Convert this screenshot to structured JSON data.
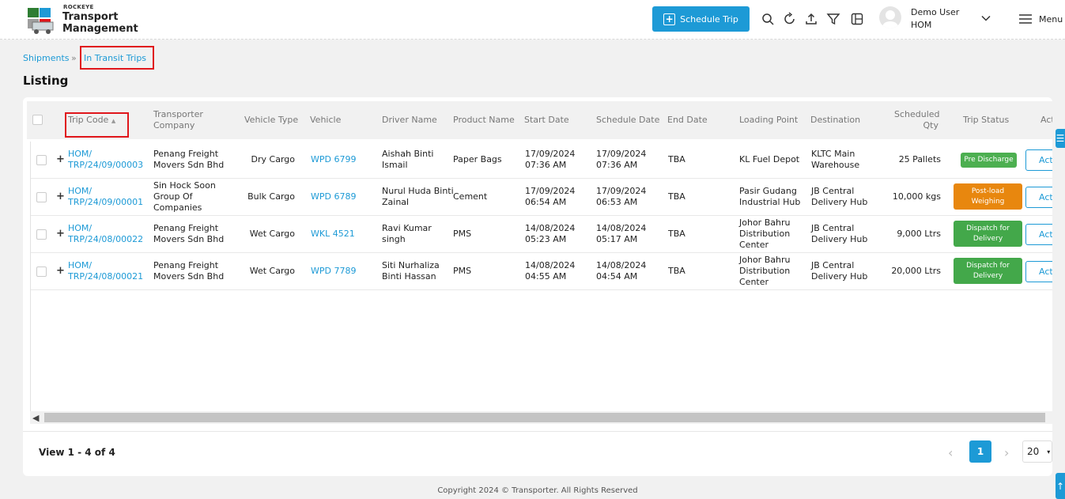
{
  "brand": {
    "small": "ROCKEYE",
    "line1": "Transport",
    "line2": "Management"
  },
  "header": {
    "schedule_label": "Schedule Trip",
    "user_name": "Demo User",
    "user_org": "HOM",
    "menu_label": "Menu"
  },
  "breadcrumb": {
    "parent": "Shipments",
    "separator": "»",
    "current": "In Transit Trips"
  },
  "page_title": "Listing",
  "columns": {
    "trip_code": "Trip Code",
    "transporter_1": "Transporter",
    "transporter_2": "Company",
    "vehicle_type": "Vehicle Type",
    "vehicle": "Vehicle",
    "driver": "Driver Name",
    "product": "Product Name",
    "start_date": "Start Date",
    "schedule_date": "Schedule Date",
    "end_date": "End Date",
    "loading_point": "Loading Point",
    "destination": "Destination",
    "scheduled_1": "Scheduled",
    "scheduled_2": "Qty",
    "trip_status": "Trip Status",
    "action": "Action"
  },
  "rows": [
    {
      "code1": "HOM/",
      "code2": "TRP/24/09/00003",
      "company": [
        "Penang Freight",
        "Movers Sdn Bhd"
      ],
      "vehicle_type": "Dry Cargo",
      "vehicle": "WPD 6799",
      "driver": [
        "Aishah Binti",
        "Ismail"
      ],
      "product": "Paper Bags",
      "start": [
        "17/09/2024",
        "07:36 AM"
      ],
      "schedule": [
        "17/09/2024",
        "07:36 AM"
      ],
      "end": "TBA",
      "loading": [
        "KL Fuel Depot"
      ],
      "destination": [
        "KLTC Main",
        "Warehouse"
      ],
      "qty": "25 Pallets",
      "status": [
        "Pre Discharge"
      ],
      "status_color": "#4caf50",
      "action": "Action"
    },
    {
      "code1": "HOM/",
      "code2": "TRP/24/09/00001",
      "company": [
        "Sin Hock Soon",
        "Group Of",
        "Companies"
      ],
      "vehicle_type": "Bulk Cargo",
      "vehicle": "WPD 6789",
      "driver": [
        "Nurul Huda Binti",
        "Zainal"
      ],
      "product": "Cement",
      "start": [
        "17/09/2024",
        "06:54 AM"
      ],
      "schedule": [
        "17/09/2024",
        "06:53 AM"
      ],
      "end": "TBA",
      "loading": [
        "Pasir Gudang",
        "Industrial Hub"
      ],
      "destination": [
        "JB Central",
        "Delivery Hub"
      ],
      "qty": "10,000 kgs",
      "status": [
        "Post-load",
        "Weighing"
      ],
      "status_color": "#e8870e",
      "action": "Action"
    },
    {
      "code1": "HOM/",
      "code2": "TRP/24/08/00022",
      "company": [
        "Penang Freight",
        "Movers Sdn Bhd"
      ],
      "vehicle_type": "Wet Cargo",
      "vehicle": "WKL 4521",
      "driver": [
        "Ravi Kumar",
        "singh"
      ],
      "product": "PMS",
      "start": [
        "14/08/2024",
        "05:23 AM"
      ],
      "schedule": [
        "14/08/2024",
        "05:17 AM"
      ],
      "end": "TBA",
      "loading": [
        "Johor Bahru",
        "Distribution",
        "Center"
      ],
      "destination": [
        "JB Central",
        "Delivery Hub"
      ],
      "qty": "9,000 Ltrs",
      "status": [
        "Dispatch for",
        "Delivery"
      ],
      "status_color": "#43a84a",
      "action": "Action"
    },
    {
      "code1": "HOM/",
      "code2": "TRP/24/08/00021",
      "company": [
        "Penang Freight",
        "Movers Sdn Bhd"
      ],
      "vehicle_type": "Wet Cargo",
      "vehicle": "WPD 7789",
      "driver": [
        "Siti Nurhaliza",
        "Binti Hassan"
      ],
      "product": "PMS",
      "start": [
        "14/08/2024",
        "04:55 AM"
      ],
      "schedule": [
        "14/08/2024",
        "04:54 AM"
      ],
      "end": "TBA",
      "loading": [
        "Johor Bahru",
        "Distribution",
        "Center"
      ],
      "destination": [
        "JB Central",
        "Delivery Hub"
      ],
      "qty": "20,000 Ltrs",
      "status": [
        "Dispatch for",
        "Delivery"
      ],
      "status_color": "#43a84a",
      "action": "Action"
    }
  ],
  "pagination": {
    "summary": "View 1 - 4 of 4",
    "current_page": "1",
    "page_size": "20",
    "prev": "‹",
    "next": "›"
  },
  "footer": {
    "copyright": "Copyright 2024 © Transporter. All Rights Reserved"
  },
  "colors": {
    "primary": "#1d9ad6",
    "highlight": "#e0161b"
  },
  "icons": [
    "search-icon",
    "refresh-icon",
    "upload-icon",
    "filter-icon",
    "columns-icon",
    "chevron-down-icon",
    "hamburger-icon"
  ]
}
